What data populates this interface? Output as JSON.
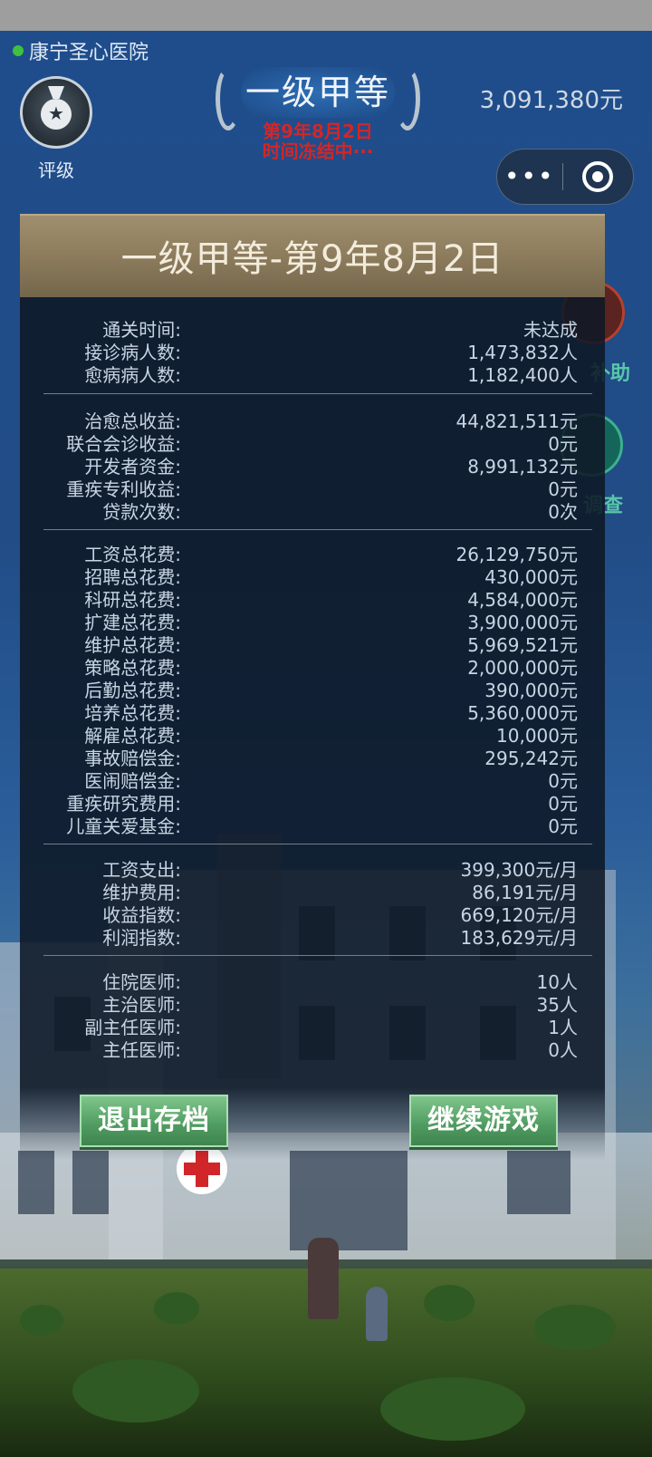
{
  "header": {
    "hospital_name": "康宁圣心医院",
    "rating_label": "评级",
    "grade": "一级甲等",
    "grade_date": "第9年8月2日",
    "grade_status": "时间冻结中···",
    "money": "3,091,380元"
  },
  "mini_program": {
    "more": "•••"
  },
  "side_buttons": {
    "subsidy": "补助",
    "survey": "调查"
  },
  "panel": {
    "title": "一级甲等-第9年8月2日",
    "sections": [
      {
        "rows": [
          {
            "label": "通关时间:",
            "value": "未达成"
          },
          {
            "label": "接诊病人数:",
            "value": "1,473,832人"
          },
          {
            "label": "愈病病人数:",
            "value": "1,182,400人"
          }
        ]
      },
      {
        "rows": [
          {
            "label": "治愈总收益:",
            "value": "44,821,511元"
          },
          {
            "label": "联合会诊收益:",
            "value": "0元"
          },
          {
            "label": "开发者资金:",
            "value": "8,991,132元"
          },
          {
            "label": "重疾专利收益:",
            "value": "0元"
          },
          {
            "label": "贷款次数:",
            "value": "0次"
          }
        ]
      },
      {
        "rows": [
          {
            "label": "工资总花费:",
            "value": "26,129,750元"
          },
          {
            "label": "招聘总花费:",
            "value": "430,000元"
          },
          {
            "label": "科研总花费:",
            "value": "4,584,000元"
          },
          {
            "label": "扩建总花费:",
            "value": "3,900,000元"
          },
          {
            "label": "维护总花费:",
            "value": "5,969,521元"
          },
          {
            "label": "策略总花费:",
            "value": "2,000,000元"
          },
          {
            "label": "后勤总花费:",
            "value": "390,000元"
          },
          {
            "label": "培养总花费:",
            "value": "5,360,000元"
          },
          {
            "label": "解雇总花费:",
            "value": "10,000元"
          },
          {
            "label": "事故赔偿金:",
            "value": "295,242元"
          },
          {
            "label": "医闹赔偿金:",
            "value": "0元"
          },
          {
            "label": "重疾研究费用:",
            "value": "0元"
          },
          {
            "label": "儿童关爱基金:",
            "value": "0元"
          }
        ]
      },
      {
        "rows": [
          {
            "label": "工资支出:",
            "value": "399,300元/月"
          },
          {
            "label": "维护费用:",
            "value": "86,191元/月"
          },
          {
            "label": "收益指数:",
            "value": "669,120元/月"
          },
          {
            "label": "利润指数:",
            "value": "183,629元/月"
          }
        ]
      },
      {
        "rows": [
          {
            "label": "住院医师:",
            "value": "10人"
          },
          {
            "label": "主治医师:",
            "value": "35人"
          },
          {
            "label": "副主任医师:",
            "value": "1人"
          },
          {
            "label": "主任医师:",
            "value": "0人"
          }
        ]
      }
    ],
    "exit_button": "退出存档",
    "continue_button": "继续游戏"
  },
  "colors": {
    "panel_header": "#8a7a5b",
    "panel_body": "#0e1826",
    "text": "#c7d5e3",
    "alert_red": "#d42626",
    "button_green": "#4f9b5f"
  }
}
